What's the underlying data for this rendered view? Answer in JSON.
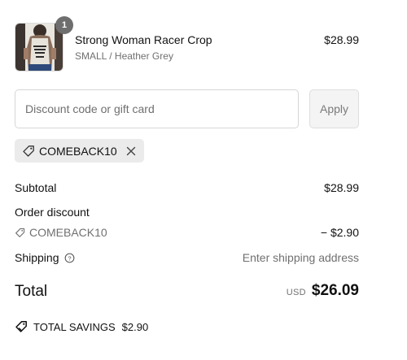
{
  "line_item": {
    "name": "Strong Woman Racer Crop",
    "variant": "SMALL / Heather Grey",
    "price": "$28.99",
    "quantity": "1",
    "image_icon": "product-photo-tank-top"
  },
  "discount": {
    "placeholder": "Discount code or gift card",
    "value": "",
    "apply_label": "Apply",
    "applied_code": "COMEBACK10",
    "remove_icon": "close-icon"
  },
  "summary": {
    "subtotal_label": "Subtotal",
    "subtotal_value": "$28.99",
    "order_discount_label": "Order discount",
    "discount_code": "COMEBACK10",
    "discount_value": "− $2.90",
    "shipping_label": "Shipping",
    "shipping_value": "Enter shipping address",
    "total_label": "Total",
    "currency": "USD",
    "total_value": "$26.09",
    "savings_label": "TOTAL SAVINGS",
    "savings_value": "$2.90"
  },
  "colors": {
    "badge": "#6e6e6e",
    "chip_bg": "#ebebeb",
    "muted_text": "#707070",
    "border": "#d6d6d6"
  }
}
